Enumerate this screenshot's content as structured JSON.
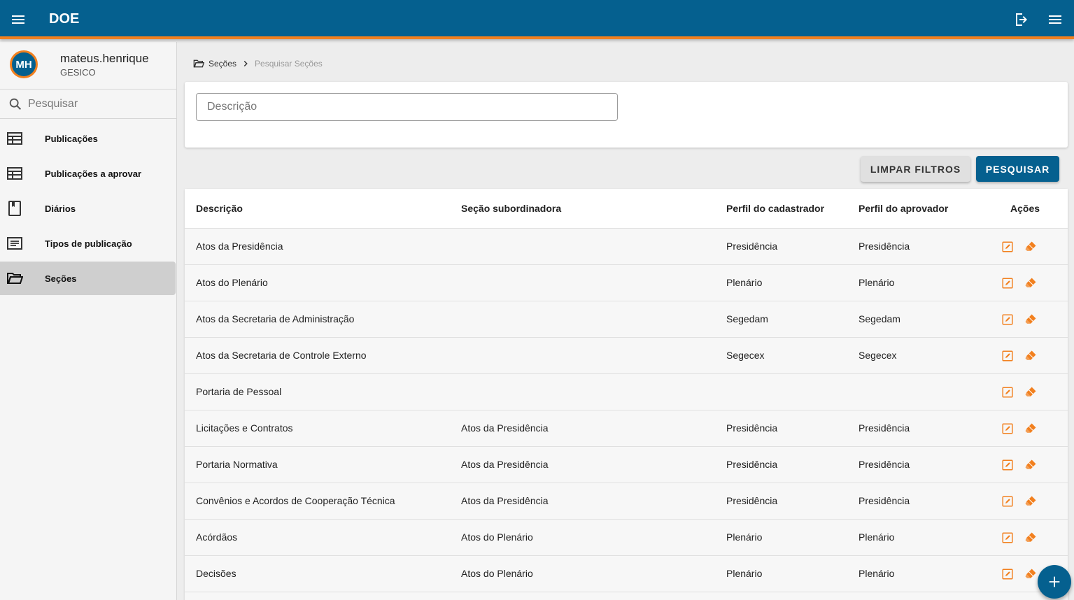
{
  "app": {
    "title": "DOE"
  },
  "header": {
    "menu_icon": "menu-icon",
    "logout_icon": "logout-icon",
    "right_menu_icon": "menu-icon"
  },
  "user": {
    "initials": "MH",
    "name": "mateus.henrique",
    "org": "GESICO"
  },
  "sidebar": {
    "search_placeholder": "Pesquisar",
    "items": [
      {
        "label": "Publicações",
        "icon": "table-icon",
        "active": false
      },
      {
        "label": "Publicações a aprovar",
        "icon": "table-icon",
        "active": false
      },
      {
        "label": "Diários",
        "icon": "book-icon",
        "active": false
      },
      {
        "label": "Tipos de publicação",
        "icon": "article-icon",
        "active": false
      },
      {
        "label": "Seções",
        "icon": "folder-open-icon",
        "active": true
      }
    ]
  },
  "breadcrumb": {
    "section": "Seções",
    "current": "Pesquisar Seções"
  },
  "filters": {
    "descricao_placeholder": "Descrição",
    "descricao_value": ""
  },
  "buttons": {
    "clear": "LIMPAR FILTROS",
    "search": "PESQUISAR"
  },
  "table": {
    "headers": {
      "descricao": "Descrição",
      "secao_subordinadora": "Seção subordinadora",
      "perfil_cadastrador": "Perfil do cadastrador",
      "perfil_aprovador": "Perfil do aprovador",
      "acoes": "Ações"
    },
    "rows": [
      {
        "descricao": "Atos da Presidência",
        "subordinadora": "",
        "cadastrador": "Presidência",
        "aprovador": "Presidência"
      },
      {
        "descricao": "Atos do Plenário",
        "subordinadora": "",
        "cadastrador": "Plenário",
        "aprovador": "Plenário"
      },
      {
        "descricao": "Atos da Secretaria de Administração",
        "subordinadora": "",
        "cadastrador": "Segedam",
        "aprovador": "Segedam"
      },
      {
        "descricao": "Atos da Secretaria de Controle Externo",
        "subordinadora": "",
        "cadastrador": "Segecex",
        "aprovador": "Segecex"
      },
      {
        "descricao": "Portaria de Pessoal",
        "subordinadora": "",
        "cadastrador": "",
        "aprovador": ""
      },
      {
        "descricao": "Licitações e Contratos",
        "subordinadora": "Atos da Presidência",
        "cadastrador": "Presidência",
        "aprovador": "Presidência"
      },
      {
        "descricao": "Portaria Normativa",
        "subordinadora": "Atos da Presidência",
        "cadastrador": "Presidência",
        "aprovador": "Presidência"
      },
      {
        "descricao": "Convênios e Acordos de Cooperação Técnica",
        "subordinadora": "Atos da Presidência",
        "cadastrador": "Presidência",
        "aprovador": "Presidência"
      },
      {
        "descricao": "Acórdãos",
        "subordinadora": "Atos do Plenário",
        "cadastrador": "Plenário",
        "aprovador": "Plenário"
      },
      {
        "descricao": "Decisões",
        "subordinadora": "Atos do Plenário",
        "cadastrador": "Plenário",
        "aprovador": "Plenário"
      }
    ]
  },
  "colors": {
    "primary": "#05608f",
    "accent": "#f2801f",
    "sidebar_bg": "#f5f5f5",
    "active_item": "#cfcfcf"
  },
  "fab": {
    "icon": "add-icon"
  }
}
